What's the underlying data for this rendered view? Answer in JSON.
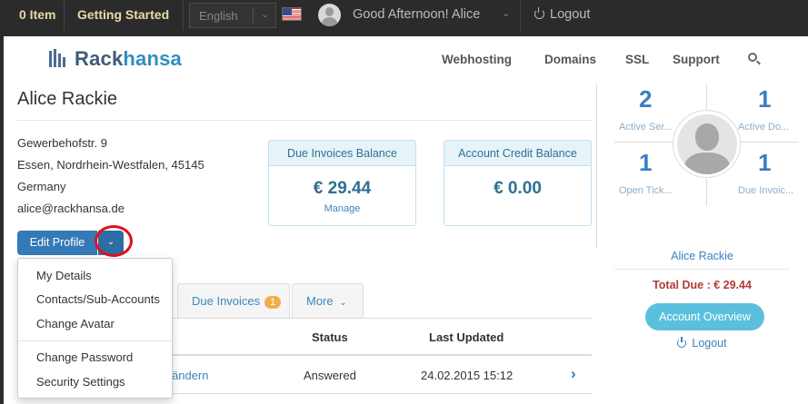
{
  "topbar": {
    "cart": "0 Item",
    "getting_started": "Getting Started",
    "language": "English",
    "greeting": "Good Afternoon! Alice",
    "logout": "Logout"
  },
  "header": {
    "logo_part1": "Rack",
    "logo_part2": "hansa",
    "nav": [
      "Webhosting",
      "Domains",
      "SSL",
      "Support"
    ]
  },
  "profile": {
    "name": "Alice Rackie",
    "address": [
      "Gewerbehofstr. 9",
      "Essen, Nordrhein-Westfalen, 45145",
      "Germany",
      "alice@rackhansa.de"
    ]
  },
  "panels": {
    "due": {
      "title": "Due Invoices Balance",
      "value": "€ 29.44",
      "link": "Manage"
    },
    "credit": {
      "title": "Account Credit Balance",
      "value": "€ 0.00"
    }
  },
  "actions": {
    "edit_profile": "Edit Profile"
  },
  "dropdown": {
    "group1": [
      "My Details",
      "Contacts/Sub-Accounts",
      "Change Avatar"
    ],
    "group2": [
      "Change Password",
      "Security Settings"
    ]
  },
  "tabs": {
    "due_invoices": "Due Invoices",
    "due_invoices_badge": "1",
    "more": "More"
  },
  "table": {
    "headers": {
      "status": "Status",
      "updated": "Last Updated"
    },
    "row": {
      "subject_fragment": "ändern",
      "status": "Answered",
      "updated": "24.02.2015 15:12"
    }
  },
  "sidebar": {
    "stats": [
      {
        "value": "2",
        "label": "Active Ser..."
      },
      {
        "value": "1",
        "label": "Active Do..."
      },
      {
        "value": "1",
        "label": "Open Tick..."
      },
      {
        "value": "1",
        "label": "Due Invoic..."
      }
    ],
    "name": "Alice Rackie",
    "total_due": "Total Due : € 29.44",
    "overview_button": "Account Overview",
    "logout": "Logout"
  }
}
